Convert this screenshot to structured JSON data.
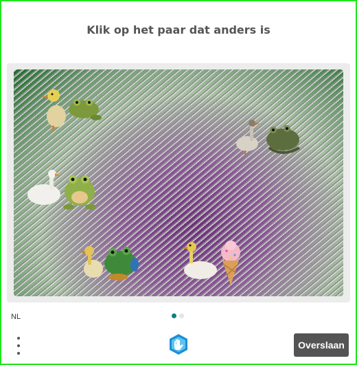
{
  "prompt": "Klik op het paar dat anders is",
  "language": "NL",
  "skip_label": "Overslaan",
  "pagination": {
    "total": 2,
    "active": 1
  },
  "pairs": [
    {
      "left": "duck",
      "right": "frog"
    },
    {
      "left": "goose",
      "right": "frog"
    },
    {
      "left": "goose",
      "right": "frog"
    },
    {
      "left": "duck",
      "right": "frog"
    },
    {
      "left": "duck",
      "right": "ice-cream"
    }
  ],
  "colors": {
    "accent": "#0b7f87",
    "frame": "#1de61d",
    "skip_bg": "#545454"
  }
}
